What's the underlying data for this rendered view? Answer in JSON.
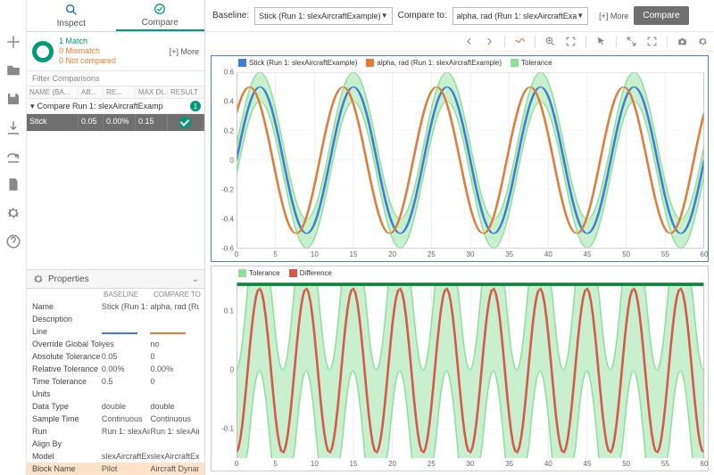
{
  "tabs": {
    "inspect": "Inspect",
    "compare": "Compare"
  },
  "summary": {
    "match": "1 Match",
    "mismatch": "0 Mismatch",
    "notcompared": "0 Not compared",
    "more": "[+] More"
  },
  "filter_label": "Filter Comparisons",
  "table": {
    "headers": {
      "name": "NAME (BA...",
      "ab": "AB...",
      "re": "RE...",
      "max": "MAX DI...",
      "result": "RESULT"
    },
    "group": {
      "label": "Compare Run 1: slexAircraftExamp",
      "badge": "1"
    },
    "row": {
      "name": "Stick",
      "ab": "0.05",
      "re": "0.00%",
      "max": "0.15"
    }
  },
  "properties": {
    "title": "Properties",
    "col_baseline": "BASELINE",
    "col_compare": "COMPARE TO",
    "rows": [
      {
        "k": "Name",
        "b": "Stick (Run 1: sl",
        "c": "alpha, rad (Run"
      },
      {
        "k": "Description",
        "b": "",
        "c": ""
      },
      {
        "k": "Line",
        "b": "",
        "c": ""
      },
      {
        "k": "Override Global Tole",
        "b": "yes",
        "c": "no"
      },
      {
        "k": "Absolute Tolerance",
        "b": "0.05",
        "c": "0"
      },
      {
        "k": "Relative Tolerance",
        "b": "0.00%",
        "c": "0.00%"
      },
      {
        "k": "Time Tolerance",
        "b": "0.5",
        "c": "0"
      },
      {
        "k": "Units",
        "b": "",
        "c": ""
      },
      {
        "k": "Data Type",
        "b": "double",
        "c": "double"
      },
      {
        "k": "Sample Time",
        "b": "Continuous",
        "c": "Continuous"
      },
      {
        "k": "Run",
        "b": "Run 1: slexAirc",
        "c": "Run 1: slexAirc"
      },
      {
        "k": "Align By",
        "b": "",
        "c": ""
      },
      {
        "k": "Model",
        "b": "slexAircraftExa",
        "c": "slexAircraftExa"
      },
      {
        "k": "Block Name",
        "b": "Pilot",
        "c": "Aircraft Dynam"
      }
    ]
  },
  "topbar": {
    "baseline_label": "Baseline:",
    "baseline_value": "Stick (Run 1: slexAircraftExample)",
    "compare_label": "Compare to:",
    "compare_value": "alpha, rad (Run 1: slexAircraftExa",
    "more": "[+] More",
    "button": "Compare"
  },
  "chart_data": [
    {
      "type": "line",
      "legend": [
        {
          "name": "Stick (Run 1: slexAircraftExample)",
          "color": "#3d7fd6"
        },
        {
          "name": "alpha, rad (Run 1: slexAircraftExample)",
          "color": "#e07b3a"
        },
        {
          "name": "Tolerance",
          "color": "#8fe09b"
        }
      ],
      "xlim": [
        0,
        60
      ],
      "ylim": [
        -0.6,
        0.6
      ],
      "xticks": [
        0,
        5,
        10,
        15,
        20,
        25,
        30,
        35,
        40,
        45,
        50,
        55,
        60
      ],
      "yticks": [
        -0.6,
        -0.4,
        -0.2,
        0,
        0.2,
        0.4,
        0.6
      ],
      "series": [
        {
          "name": "Stick",
          "amplitude": 0.5,
          "period": 12,
          "phase": 0
        },
        {
          "name": "alpha",
          "amplitude": 0.5,
          "period": 12,
          "phase": 0.7
        }
      ],
      "tolerance_band": 0.1
    },
    {
      "type": "line",
      "legend": [
        {
          "name": "Tolerance",
          "color": "#8fe09b"
        },
        {
          "name": "Difference",
          "color": "#d65a4a"
        }
      ],
      "xlim": [
        0,
        60
      ],
      "ylim": [
        -0.15,
        0.15
      ],
      "xticks": [
        0,
        5,
        10,
        15,
        20,
        25,
        30,
        35,
        40,
        45,
        50,
        55,
        60
      ],
      "yticks": [
        -0.1,
        0,
        0.1
      ],
      "series": [
        {
          "name": "Difference",
          "amplitude": 0.14,
          "period": 6,
          "phase": -1.5
        }
      ],
      "tolerance_band": 0.14,
      "top_bar": true
    }
  ]
}
